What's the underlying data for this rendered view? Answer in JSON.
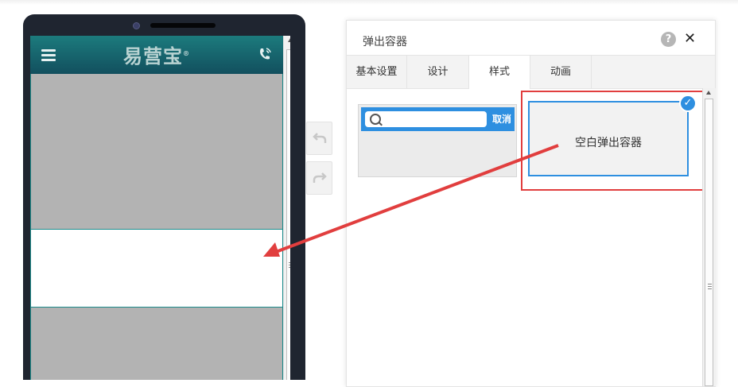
{
  "phone": {
    "brand": "易营宝",
    "brand_mark": "®",
    "icons": {
      "menu": "hamburger-menu-icon",
      "call": "phone-call-icon"
    }
  },
  "side_buttons": {
    "undo_icon": "undo-icon",
    "redo_icon": "redo-icon"
  },
  "dialog": {
    "title": "弹出容器",
    "help_label": "?",
    "close_label": "✕",
    "tabs": [
      {
        "label": "基本设置",
        "active": false
      },
      {
        "label": "设计",
        "active": false
      },
      {
        "label": "样式",
        "active": true
      },
      {
        "label": "动画",
        "active": false
      }
    ],
    "styles": [
      {
        "name": "search-style",
        "cancel_text": "取消"
      },
      {
        "name": "blank-style",
        "label": "空白弹出容器",
        "selected": true,
        "check": "✓"
      }
    ]
  },
  "colors": {
    "accent_blue": "#2e8fe0",
    "highlight_red": "#e13e3e",
    "phone_header_teal": "#1c7b7d",
    "phone_body": "#1f2530"
  }
}
